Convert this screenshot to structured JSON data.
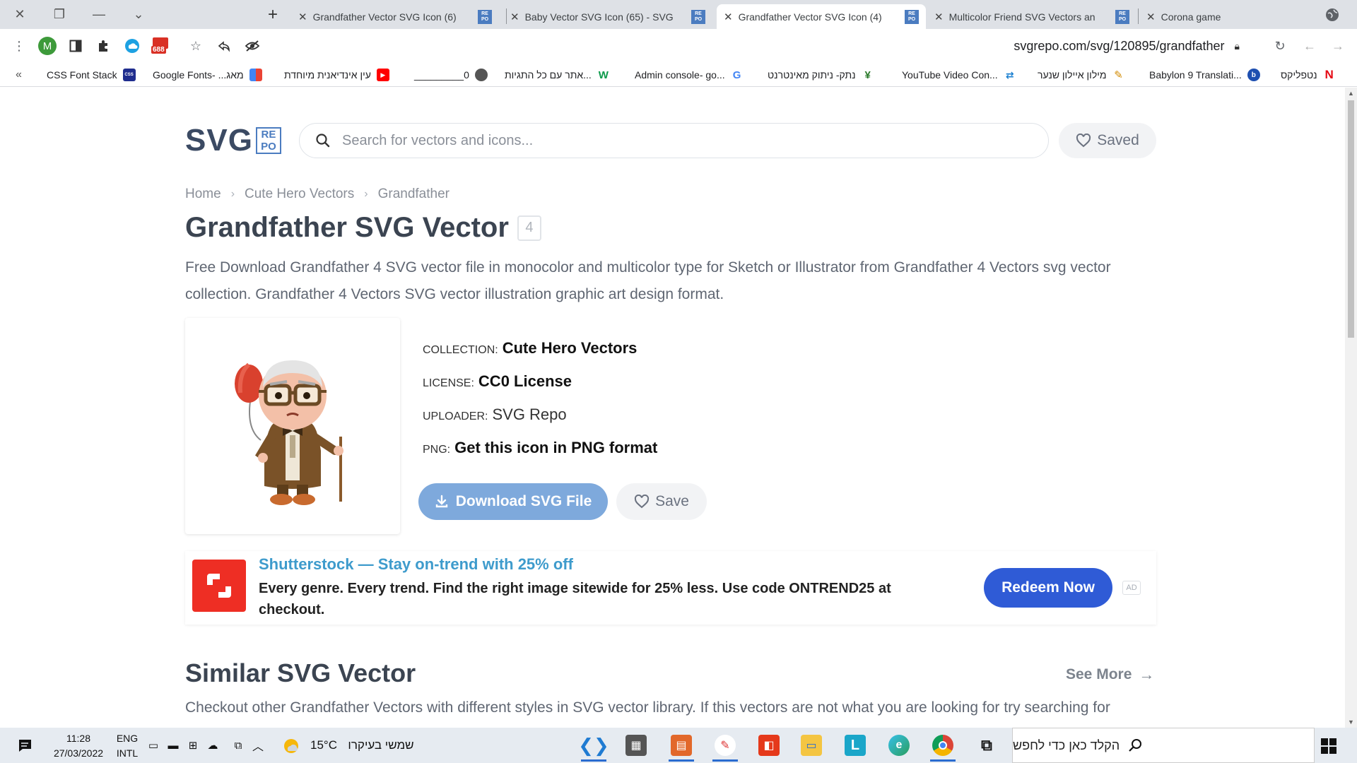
{
  "browser": {
    "tabs": [
      {
        "title": "Grandfather Vector SVG Icon (6)",
        "favicon": "SVG REPO"
      },
      {
        "title": "Baby Vector SVG Icon (65) - SVG",
        "favicon": "SVG REPO"
      },
      {
        "title": "Grandfather Vector SVG Icon (4)",
        "favicon": "SVG REPO",
        "active": true
      },
      {
        "title": "Multicolor Friend SVG Vectors an",
        "favicon": "SVG REPO"
      },
      {
        "title": "Corona game",
        "favicon": "globe-icon"
      }
    ],
    "url": "svgrepo.com/svg/120895/grandfather",
    "extension_badge": "688",
    "profile_initial": "M",
    "bookmarks_more": "«",
    "bookmarks": [
      {
        "label": "CSS Font Stack",
        "icon": "cssfontstack-icon"
      },
      {
        "label": "Google Fonts- ...מאג",
        "icon": "google-fonts-icon"
      },
      {
        "label": "עין אינדיאנית מיוחדת",
        "icon": "youtube-icon"
      },
      {
        "label": "_________0",
        "icon": "globe-icon"
      },
      {
        "label": "אתר עם כל התגיות...",
        "icon": "w-icon"
      },
      {
        "label": "Admin console- go...",
        "icon": "google-icon"
      },
      {
        "label": "נתק- ניתוק מאינטרנט",
        "icon": "plant-icon"
      },
      {
        "label": "YouTube Video Con...",
        "icon": "converter-icon"
      },
      {
        "label": "מילון איילון שנער",
        "icon": "quill-icon"
      },
      {
        "label": "Babylon 9 Translati...",
        "icon": "babylon-icon"
      },
      {
        "label": "נטפליקס",
        "icon": "netflix-icon"
      }
    ]
  },
  "site": {
    "logo": {
      "text": "SVG",
      "badge": [
        "RE",
        "PO"
      ]
    },
    "search_placeholder": "Search for vectors and icons...",
    "saved_label": "Saved"
  },
  "breadcrumb": [
    "Home",
    "Cute Hero Vectors",
    "Grandfather"
  ],
  "page": {
    "title": "Grandfather SVG Vector",
    "variant_count": "4",
    "description": "Free Download Grandfather 4 SVG vector file in monocolor and multicolor type for Sketch or Illustrator from Grandfather 4 Vectors svg vector collection. Grandfather 4 Vectors SVG vector illustration graphic art design format."
  },
  "meta": {
    "collection_label": "COLLECTION:",
    "collection_value": "Cute Hero Vectors",
    "license_label": "LICENSE:",
    "license_value": "CC0 License",
    "uploader_label": "UPLOADER:",
    "uploader_value": "SVG Repo",
    "png_label": "PNG:",
    "png_value": "Get this icon in PNG format"
  },
  "actions": {
    "download_label": "Download SVG File",
    "save_label": "Save"
  },
  "ad": {
    "title": "Shutterstock — Stay on-trend with 25% off",
    "body": "Every genre. Every trend. Find the right image sitewide for 25% less. Use code ONTREND25 at checkout.",
    "cta": "Redeem Now",
    "badge": "AD"
  },
  "similar": {
    "title": "Similar SVG Vector",
    "see_more": "See More",
    "description": "Checkout other Grandfather Vectors with different styles in SVG vector library. If this vectors are not what you are looking for try searching for"
  },
  "taskbar": {
    "time": "11:28",
    "date": "27/03/2022",
    "lang_top": "ENG",
    "lang_bottom": "INTL",
    "weather_temp": "15°C",
    "weather_text": "שמשי בעיקרו",
    "search_placeholder": "הקלד כאן כדי לחפש",
    "apps": [
      "vscode-icon",
      "calculator-icon",
      "slides-icon",
      "paint-icon",
      "office-icon",
      "file-explorer-icon",
      "l-app-icon",
      "edge-icon",
      "chrome-icon",
      "task-view-icon"
    ]
  },
  "colors": {
    "brand": "#4b7cc0",
    "download_button": "#7ea9dc",
    "ad_cta": "#2f5bd6",
    "ad_title": "#3e9bcc"
  }
}
